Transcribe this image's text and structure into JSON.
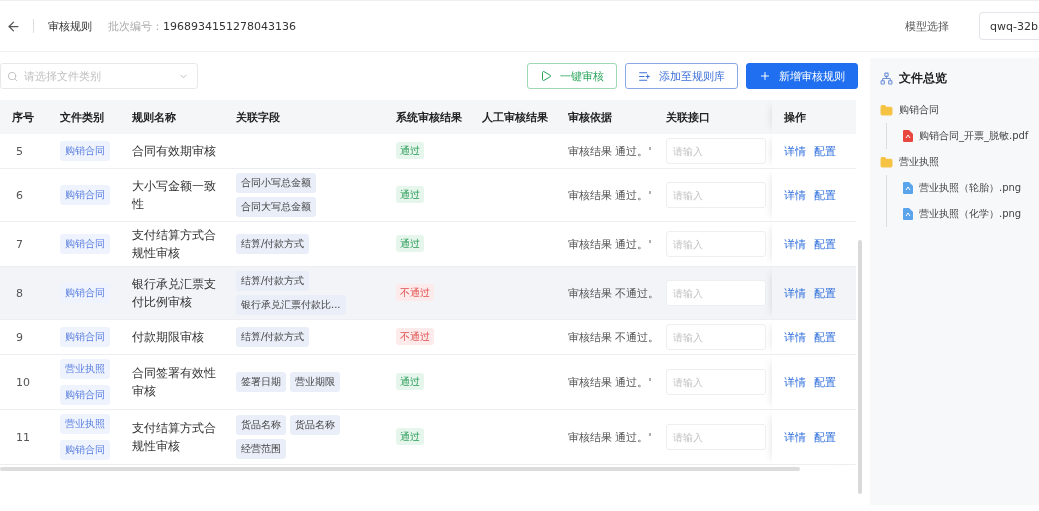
{
  "header": {
    "title": "审核规则",
    "batch_label": "批次编号：",
    "batch_number": "1968934151278043136",
    "model_label": "模型选择",
    "model_value": "qwq-32b"
  },
  "toolbar": {
    "search_placeholder": "请选择文件类别",
    "buttons": [
      {
        "label": "一键审核",
        "kind": "success"
      },
      {
        "label": "添加至规则库",
        "kind": "outline"
      },
      {
        "label": "新增审核规则",
        "kind": "primary"
      }
    ]
  },
  "table": {
    "columns": [
      "序号",
      "文件类别",
      "规则名称",
      "关联字段",
      "系统审核结果",
      "人工审核结果",
      "审核依据",
      "关联接口",
      "操作"
    ],
    "rows": [
      {
        "index": "5",
        "categories": [
          "购销合同"
        ],
        "name": "合同有效期审核",
        "fields": [],
        "result": {
          "text": "通过",
          "kind": "pass"
        },
        "basis": "审核结果 通过。'",
        "interface_placeholder": "请输入",
        "actions": [
          "详情",
          "配置"
        ],
        "highlighted": false
      },
      {
        "index": "6",
        "categories": [
          "购销合同"
        ],
        "name": "大小写金额一致性",
        "fields": [
          "合同小写总金额",
          "合同大写总金额"
        ],
        "result": {
          "text": "通过",
          "kind": "pass"
        },
        "basis": "审核结果 通过。'",
        "interface_placeholder": "请输入",
        "actions": [
          "详情",
          "配置"
        ],
        "highlighted": false
      },
      {
        "index": "7",
        "categories": [
          "购销合同"
        ],
        "name": "支付结算方式合规性审核",
        "fields": [
          "结算/付款方式"
        ],
        "result": {
          "text": "通过",
          "kind": "pass"
        },
        "basis": "审核结果 通过。'",
        "interface_placeholder": "请输入",
        "actions": [
          "详情",
          "配置"
        ],
        "highlighted": false
      },
      {
        "index": "8",
        "categories": [
          "购销合同"
        ],
        "name": "银行承兑汇票支付比例审核",
        "fields": [
          "结算/付款方式",
          "银行承兑汇票付款比..."
        ],
        "result": {
          "text": "不通过",
          "kind": "fail"
        },
        "basis": "审核结果 不通过。",
        "interface_placeholder": "请输入",
        "actions": [
          "详情",
          "配置"
        ],
        "highlighted": true
      },
      {
        "index": "9",
        "categories": [
          "购销合同"
        ],
        "name": "付款期限审核",
        "fields": [
          "结算/付款方式"
        ],
        "result": {
          "text": "不通过",
          "kind": "fail"
        },
        "basis": "审核结果 不通过。",
        "interface_placeholder": "请输入",
        "actions": [
          "详情",
          "配置"
        ],
        "highlighted": false
      },
      {
        "index": "10",
        "categories": [
          "营业执照",
          "购销合同"
        ],
        "name": "合同签署有效性审核",
        "fields": [
          "签署日期",
          "营业期限"
        ],
        "result": {
          "text": "通过",
          "kind": "pass"
        },
        "basis": "审核结果 通过。'",
        "interface_placeholder": "请输入",
        "actions": [
          "详情",
          "配置"
        ],
        "highlighted": false
      },
      {
        "index": "11",
        "categories": [
          "营业执照",
          "购销合同"
        ],
        "name": "支付结算方式合规性审核",
        "fields": [
          "货品名称",
          "货品名称",
          "经营范围"
        ],
        "result": {
          "text": "通过",
          "kind": "pass"
        },
        "basis": "审核结果 通过。'",
        "interface_placeholder": "请输入",
        "actions": [
          "详情",
          "配置"
        ],
        "highlighted": false
      }
    ]
  },
  "file_overview": {
    "title": "文件总览",
    "tree": [
      {
        "label": "购销合同",
        "kind": "folder",
        "children": [
          {
            "label": "购销合同_开票_脱敏.pdf",
            "kind": "pdf"
          }
        ]
      },
      {
        "label": "营业执照",
        "kind": "folder",
        "children": [
          {
            "label": "营业执照（轮胎）.png",
            "kind": "image"
          },
          {
            "label": "营业执照（化学）.png",
            "kind": "image"
          }
        ]
      }
    ]
  }
}
